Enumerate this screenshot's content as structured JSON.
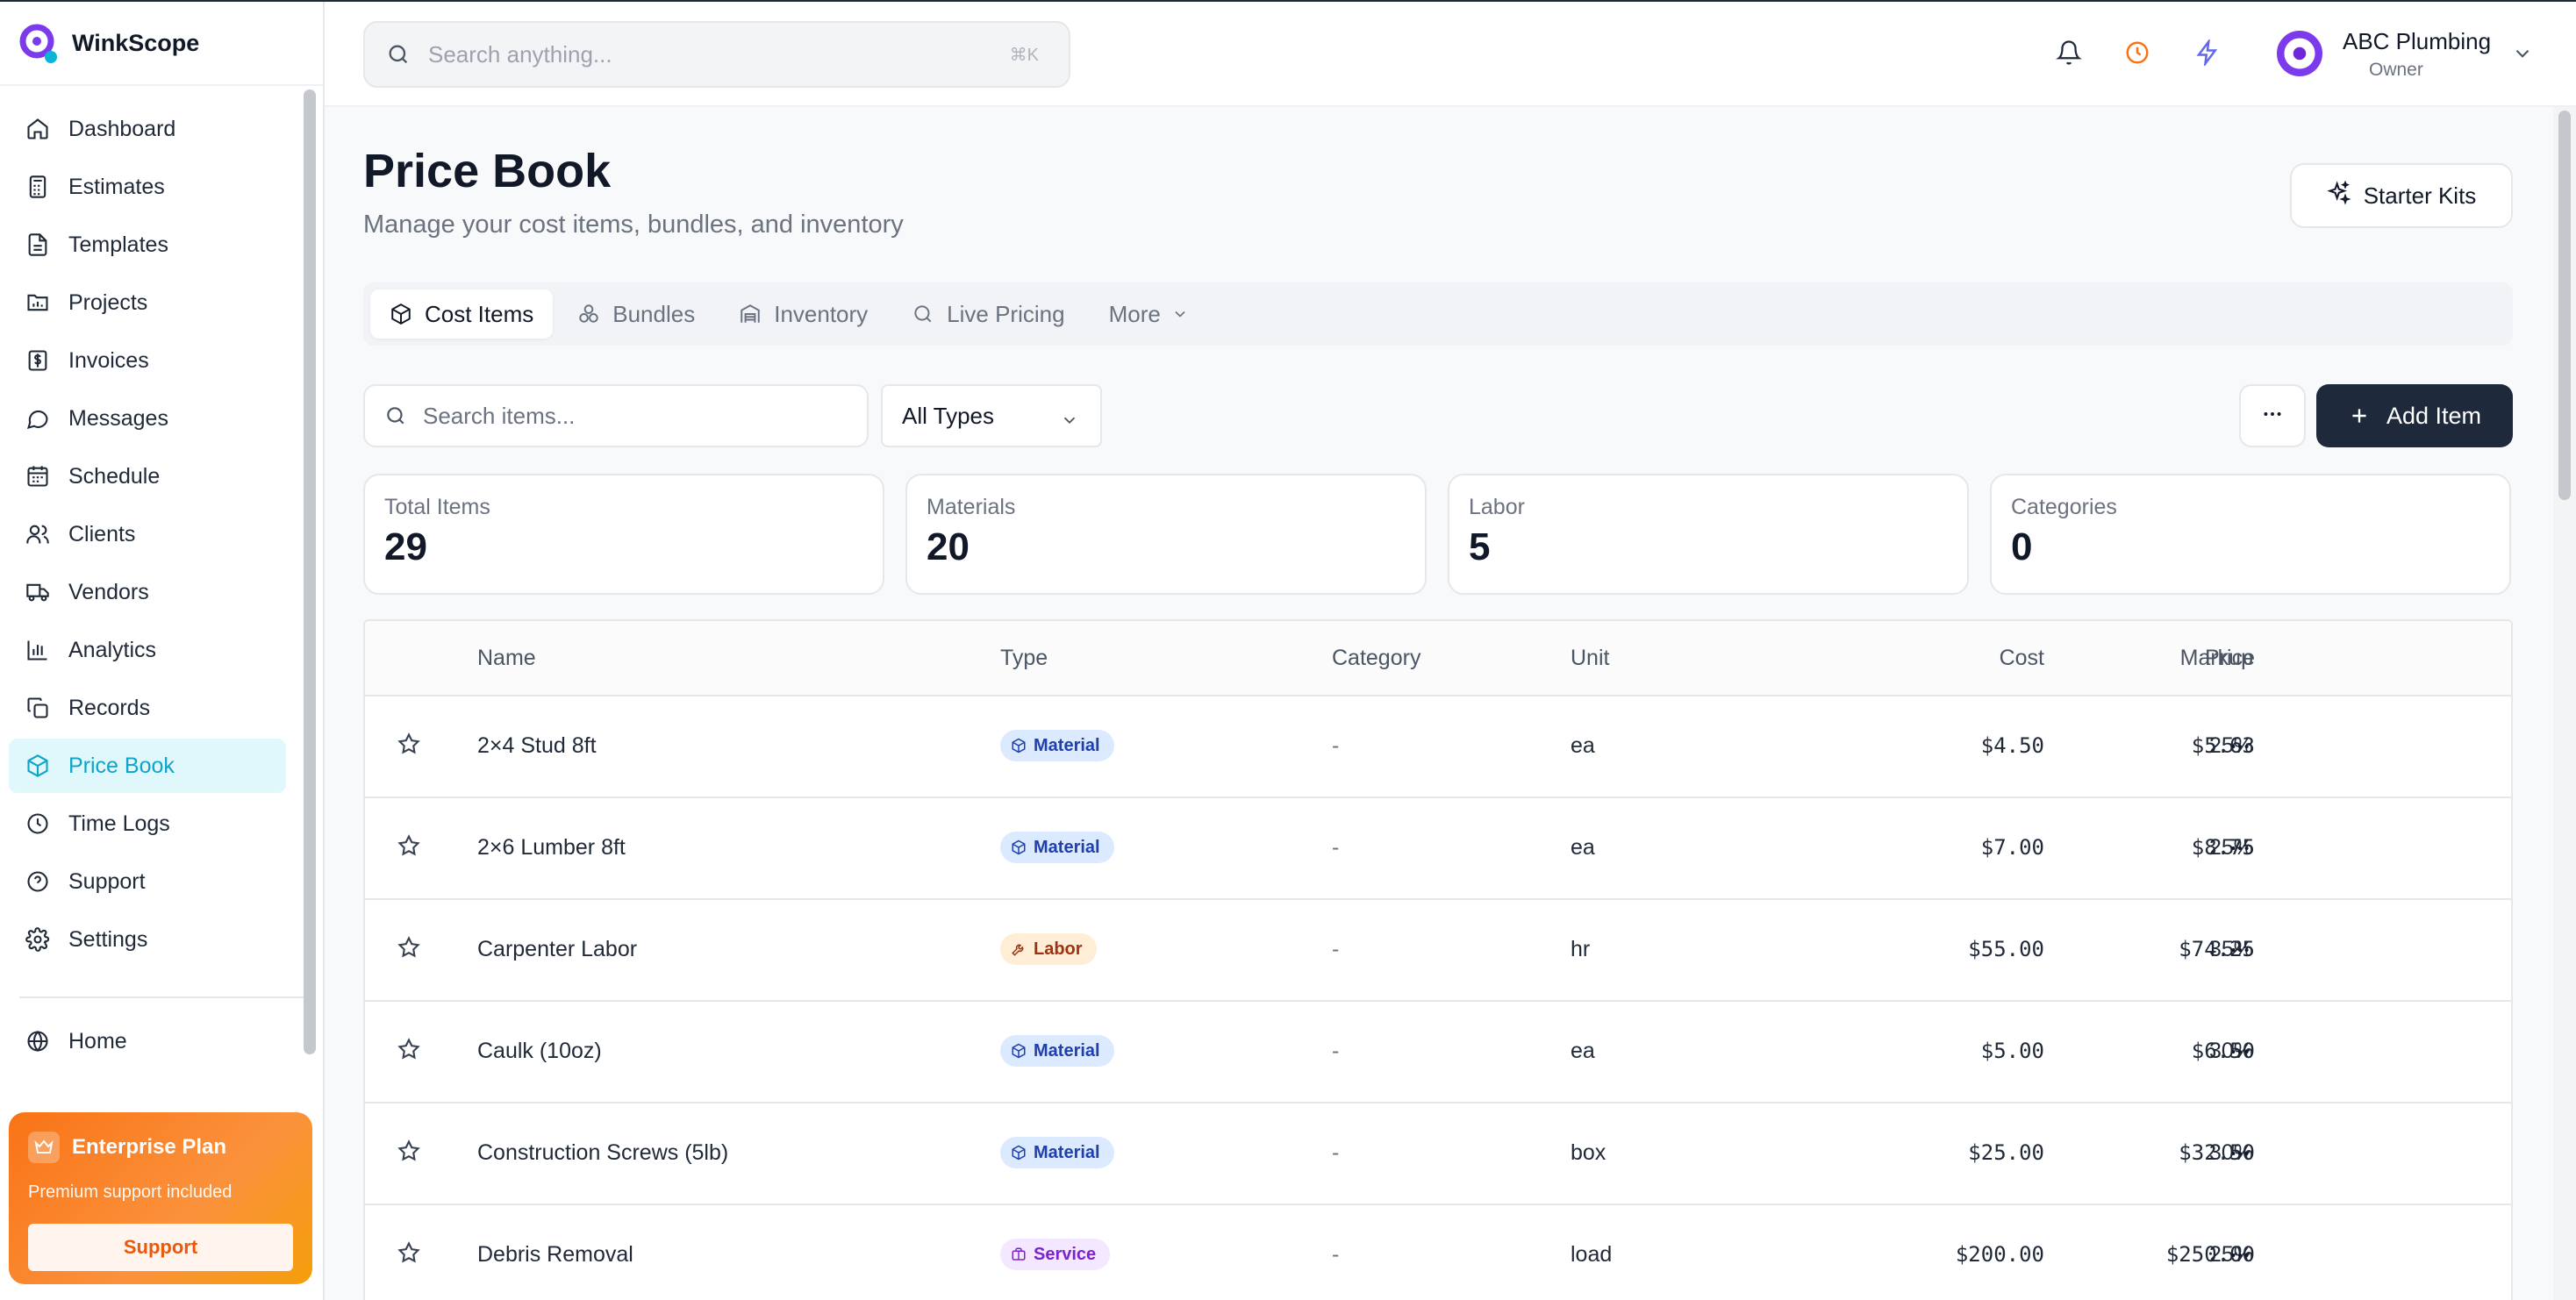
{
  "app": {
    "name": "WinkScope"
  },
  "sidebar": {
    "items": [
      {
        "label": "Dashboard",
        "icon": "home-icon"
      },
      {
        "label": "Estimates",
        "icon": "calculator-icon"
      },
      {
        "label": "Templates",
        "icon": "file-icon"
      },
      {
        "label": "Projects",
        "icon": "folder-chart-icon"
      },
      {
        "label": "Invoices",
        "icon": "dollar-receipt-icon"
      },
      {
        "label": "Messages",
        "icon": "chat-icon"
      },
      {
        "label": "Schedule",
        "icon": "calendar-icon"
      },
      {
        "label": "Clients",
        "icon": "users-icon"
      },
      {
        "label": "Vendors",
        "icon": "truck-icon"
      },
      {
        "label": "Analytics",
        "icon": "bar-chart-icon"
      },
      {
        "label": "Records",
        "icon": "copy-icon"
      },
      {
        "label": "Price Book",
        "icon": "package-icon",
        "active": true
      },
      {
        "label": "Time Logs",
        "icon": "clock-icon"
      },
      {
        "label": "Support",
        "icon": "help-circle-icon"
      },
      {
        "label": "Settings",
        "icon": "gear-icon"
      }
    ],
    "home": {
      "label": "Home",
      "icon": "globe-icon"
    },
    "plan": {
      "title": "Enterprise Plan",
      "subtitle": "Premium support included",
      "button": "Support"
    }
  },
  "topbar": {
    "search_placeholder": "Search anything...",
    "shortcut": "⌘K",
    "account": {
      "name": "ABC Plumbing",
      "role": "Owner"
    }
  },
  "page": {
    "title": "Price Book",
    "subtitle": "Manage your cost items, bundles, and inventory",
    "starter_button": "Starter Kits"
  },
  "tabs": [
    {
      "label": "Cost Items",
      "active": true
    },
    {
      "label": "Bundles"
    },
    {
      "label": "Inventory"
    },
    {
      "label": "Live Pricing"
    },
    {
      "label": "More"
    }
  ],
  "toolbar": {
    "search_placeholder": "Search items...",
    "type_filter": "All Types",
    "add_label": "Add Item"
  },
  "stats": [
    {
      "label": "Total Items",
      "value": "29"
    },
    {
      "label": "Materials",
      "value": "20"
    },
    {
      "label": "Labor",
      "value": "5"
    },
    {
      "label": "Categories",
      "value": "0"
    }
  ],
  "table": {
    "headers": {
      "name": "Name",
      "type": "Type",
      "category": "Category",
      "unit": "Unit",
      "cost": "Cost",
      "markup": "Markup",
      "price": "Price"
    },
    "rows": [
      {
        "name": "2×4 Stud 8ft",
        "type": "Material",
        "category": "-",
        "unit": "ea",
        "cost": "$4.50",
        "markup": "25%",
        "price": "$5.63"
      },
      {
        "name": "2×6 Lumber 8ft",
        "type": "Material",
        "category": "-",
        "unit": "ea",
        "cost": "$7.00",
        "markup": "25%",
        "price": "$8.75"
      },
      {
        "name": "Carpenter Labor",
        "type": "Labor",
        "category": "-",
        "unit": "hr",
        "cost": "$55.00",
        "markup": "35%",
        "price": "$74.25"
      },
      {
        "name": "Caulk (10oz)",
        "type": "Material",
        "category": "-",
        "unit": "ea",
        "cost": "$5.00",
        "markup": "30%",
        "price": "$6.50"
      },
      {
        "name": "Construction Screws (5lb)",
        "type": "Material",
        "category": "-",
        "unit": "box",
        "cost": "$25.00",
        "markup": "30%",
        "price": "$32.50"
      },
      {
        "name": "Debris Removal",
        "type": "Service",
        "category": "-",
        "unit": "load",
        "cost": "$200.00",
        "markup": "25%",
        "price": "$250.00"
      }
    ]
  },
  "colors": {
    "accent": "#0ea5c6",
    "primary_button": "#1e293b",
    "brand_purple": "#7c3aed",
    "plan_orange": "#f97316"
  }
}
